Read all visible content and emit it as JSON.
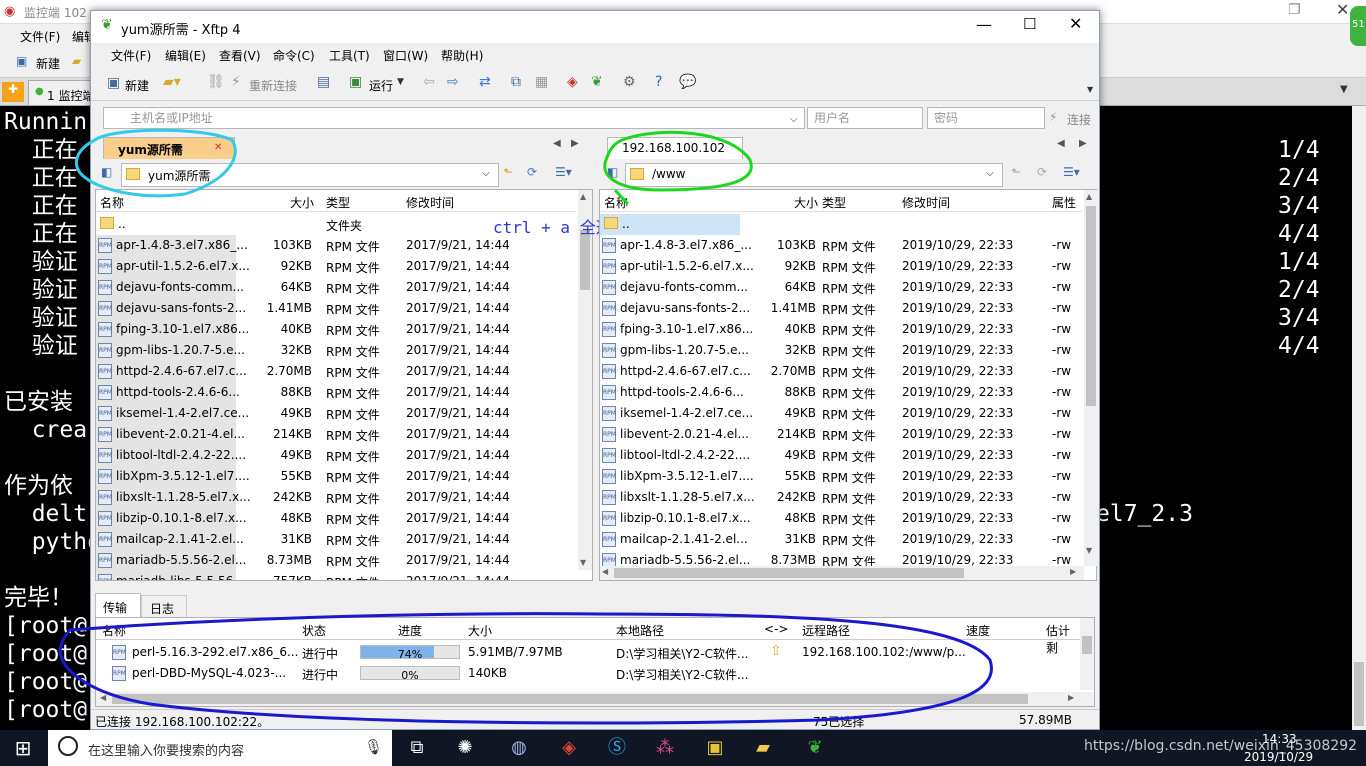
{
  "background_app": {
    "title": "监控端 102",
    "menu": [
      "文件(F)",
      "编辑"
    ],
    "toolbar_new": "新建",
    "tab_label": "1 监控端",
    "terminal_lines_left": [
      "Runnin",
      "  正在",
      "  正在",
      "  正在",
      "  正在",
      "  验证",
      "  验证",
      "  验证",
      "  验证",
      "",
      "已安装",
      "  crea",
      "",
      "作为依",
      "  delt",
      "  pytho",
      "",
      "完毕！",
      "[root@",
      "[root@",
      "[root@",
      "[root@"
    ],
    "terminal_counts": [
      "1/4",
      "2/4",
      "3/4",
      "4/4",
      "1/4",
      "2/4",
      "3/4",
      "4/4"
    ],
    "terminal_right_fragment": "el7_2.3"
  },
  "xftp": {
    "title": "yum源所需 - Xftp 4",
    "menu": [
      "文件(F)",
      "编辑(E)",
      "查看(V)",
      "命令(C)",
      "工具(T)",
      "窗口(W)",
      "帮助(H)"
    ],
    "toolbar": {
      "new": "新建",
      "reconnect": "重新连接",
      "run": "运行"
    },
    "address": {
      "host_placeholder": "主机名或IP地址",
      "user_placeholder": "用户名",
      "password_placeholder": "密码",
      "connect": "连接"
    },
    "annotation": "ctrl + a 全选",
    "columns": {
      "name": "名称",
      "size": "大小",
      "type": "类型",
      "modified": "修改时间",
      "attr": "属性"
    },
    "left": {
      "tab": "yum源所需",
      "path": "yum源所需",
      "parent": "..",
      "parent_type": "文件夹",
      "files": [
        {
          "name": "apr-1.4.8-3.el7.x86_...",
          "size": "103KB",
          "type": "RPM 文件",
          "modified": "2017/9/21, 14:44"
        },
        {
          "name": "apr-util-1.5.2-6.el7.x...",
          "size": "92KB",
          "type": "RPM 文件",
          "modified": "2017/9/21, 14:44"
        },
        {
          "name": "dejavu-fonts-comm...",
          "size": "64KB",
          "type": "RPM 文件",
          "modified": "2017/9/21, 14:44"
        },
        {
          "name": "dejavu-sans-fonts-2...",
          "size": "1.41MB",
          "type": "RPM 文件",
          "modified": "2017/9/21, 14:44"
        },
        {
          "name": "fping-3.10-1.el7.x86...",
          "size": "40KB",
          "type": "RPM 文件",
          "modified": "2017/9/21, 14:44"
        },
        {
          "name": "gpm-libs-1.20.7-5.e...",
          "size": "32KB",
          "type": "RPM 文件",
          "modified": "2017/9/21, 14:44"
        },
        {
          "name": "httpd-2.4.6-67.el7.c...",
          "size": "2.70MB",
          "type": "RPM 文件",
          "modified": "2017/9/21, 14:44"
        },
        {
          "name": "httpd-tools-2.4.6-6...",
          "size": "88KB",
          "type": "RPM 文件",
          "modified": "2017/9/21, 14:44"
        },
        {
          "name": "iksemel-1.4-2.el7.ce...",
          "size": "49KB",
          "type": "RPM 文件",
          "modified": "2017/9/21, 14:44"
        },
        {
          "name": "libevent-2.0.21-4.el...",
          "size": "214KB",
          "type": "RPM 文件",
          "modified": "2017/9/21, 14:44"
        },
        {
          "name": "libtool-ltdl-2.4.2-22....",
          "size": "49KB",
          "type": "RPM 文件",
          "modified": "2017/9/21, 14:44"
        },
        {
          "name": "libXpm-3.5.12-1.el7....",
          "size": "55KB",
          "type": "RPM 文件",
          "modified": "2017/9/21, 14:44"
        },
        {
          "name": "libxslt-1.1.28-5.el7.x...",
          "size": "242KB",
          "type": "RPM 文件",
          "modified": "2017/9/21, 14:44"
        },
        {
          "name": "libzip-0.10.1-8.el7.x...",
          "size": "48KB",
          "type": "RPM 文件",
          "modified": "2017/9/21, 14:44"
        },
        {
          "name": "mailcap-2.1.41-2.el...",
          "size": "31KB",
          "type": "RPM 文件",
          "modified": "2017/9/21, 14:44"
        },
        {
          "name": "mariadb-5.5.56-2.el...",
          "size": "8.73MB",
          "type": "RPM 文件",
          "modified": "2017/9/21, 14:44"
        },
        {
          "name": "mariadb-libs-5.5.56...",
          "size": "757KB",
          "type": "RPM 文件",
          "modified": "2017/9/21, 14:44"
        }
      ]
    },
    "right": {
      "tab": "192.168.100.102",
      "path": "/www",
      "parent": "..",
      "files": [
        {
          "name": "apr-1.4.8-3.el7.x86_...",
          "size": "103KB",
          "type": "RPM 文件",
          "modified": "2019/10/29, 22:33",
          "attr": "-rw"
        },
        {
          "name": "apr-util-1.5.2-6.el7.x...",
          "size": "92KB",
          "type": "RPM 文件",
          "modified": "2019/10/29, 22:33",
          "attr": "-rw"
        },
        {
          "name": "dejavu-fonts-comm...",
          "size": "64KB",
          "type": "RPM 文件",
          "modified": "2019/10/29, 22:33",
          "attr": "-rw"
        },
        {
          "name": "dejavu-sans-fonts-2...",
          "size": "1.41MB",
          "type": "RPM 文件",
          "modified": "2019/10/29, 22:33",
          "attr": "-rw"
        },
        {
          "name": "fping-3.10-1.el7.x86...",
          "size": "40KB",
          "type": "RPM 文件",
          "modified": "2019/10/29, 22:33",
          "attr": "-rw"
        },
        {
          "name": "gpm-libs-1.20.7-5.e...",
          "size": "32KB",
          "type": "RPM 文件",
          "modified": "2019/10/29, 22:33",
          "attr": "-rw"
        },
        {
          "name": "httpd-2.4.6-67.el7.c...",
          "size": "2.70MB",
          "type": "RPM 文件",
          "modified": "2019/10/29, 22:33",
          "attr": "-rw"
        },
        {
          "name": "httpd-tools-2.4.6-6...",
          "size": "88KB",
          "type": "RPM 文件",
          "modified": "2019/10/29, 22:33",
          "attr": "-rw"
        },
        {
          "name": "iksemel-1.4-2.el7.ce...",
          "size": "49KB",
          "type": "RPM 文件",
          "modified": "2019/10/29, 22:33",
          "attr": "-rw"
        },
        {
          "name": "libevent-2.0.21-4.el...",
          "size": "214KB",
          "type": "RPM 文件",
          "modified": "2019/10/29, 22:33",
          "attr": "-rw"
        },
        {
          "name": "libtool-ltdl-2.4.2-22....",
          "size": "49KB",
          "type": "RPM 文件",
          "modified": "2019/10/29, 22:33",
          "attr": "-rw"
        },
        {
          "name": "libXpm-3.5.12-1.el7....",
          "size": "55KB",
          "type": "RPM 文件",
          "modified": "2019/10/29, 22:33",
          "attr": "-rw"
        },
        {
          "name": "libxslt-1.1.28-5.el7.x...",
          "size": "242KB",
          "type": "RPM 文件",
          "modified": "2019/10/29, 22:33",
          "attr": "-rw"
        },
        {
          "name": "libzip-0.10.1-8.el7.x...",
          "size": "48KB",
          "type": "RPM 文件",
          "modified": "2019/10/29, 22:33",
          "attr": "-rw"
        },
        {
          "name": "mailcap-2.1.41-2.el...",
          "size": "31KB",
          "type": "RPM 文件",
          "modified": "2019/10/29, 22:33",
          "attr": "-rw"
        },
        {
          "name": "mariadb-5.5.56-2.el...",
          "size": "8.73MB",
          "type": "RPM 文件",
          "modified": "2019/10/29, 22:33",
          "attr": "-rw"
        }
      ]
    },
    "transfer": {
      "tabs": [
        "传输",
        "日志"
      ],
      "columns": [
        "名称",
        "状态",
        "进度",
        "大小",
        "本地路径",
        "<->",
        "远程路径",
        "速度",
        "估计剩"
      ],
      "rows": [
        {
          "name": "perl-5.16.3-292.el7.x86_6...",
          "status": "进行中",
          "progress_text": "74%",
          "progress": 0.74,
          "size": "5.91MB/7.97MB",
          "local": "D:\\学习相关\\Y2-C软件...",
          "remote": "192.168.100.102:/www/p..."
        },
        {
          "name": "perl-DBD-MySQL-4.023-...",
          "status": "进行中",
          "progress_text": "0%",
          "progress": 0.0,
          "size": "140KB",
          "local": "D:\\学习相关\\Y2-C软件...",
          "remote": ""
        }
      ]
    },
    "status": {
      "connected": "已连接 192.168.100.102:22。",
      "selected": "75已选择",
      "size": "57.89MB"
    }
  },
  "taskbar": {
    "search_placeholder": "在这里输入你要搜索的内容",
    "time": "14:33",
    "date": "2019/10/29",
    "watermark": "https://blog.csdn.net/weixin_45308292",
    "badge": "51"
  },
  "colors": {
    "annot_cyan": "#33c9e8",
    "annot_green": "#1ed61e",
    "annot_blue": "#1a1acc",
    "progress": "#7fb3ea"
  }
}
